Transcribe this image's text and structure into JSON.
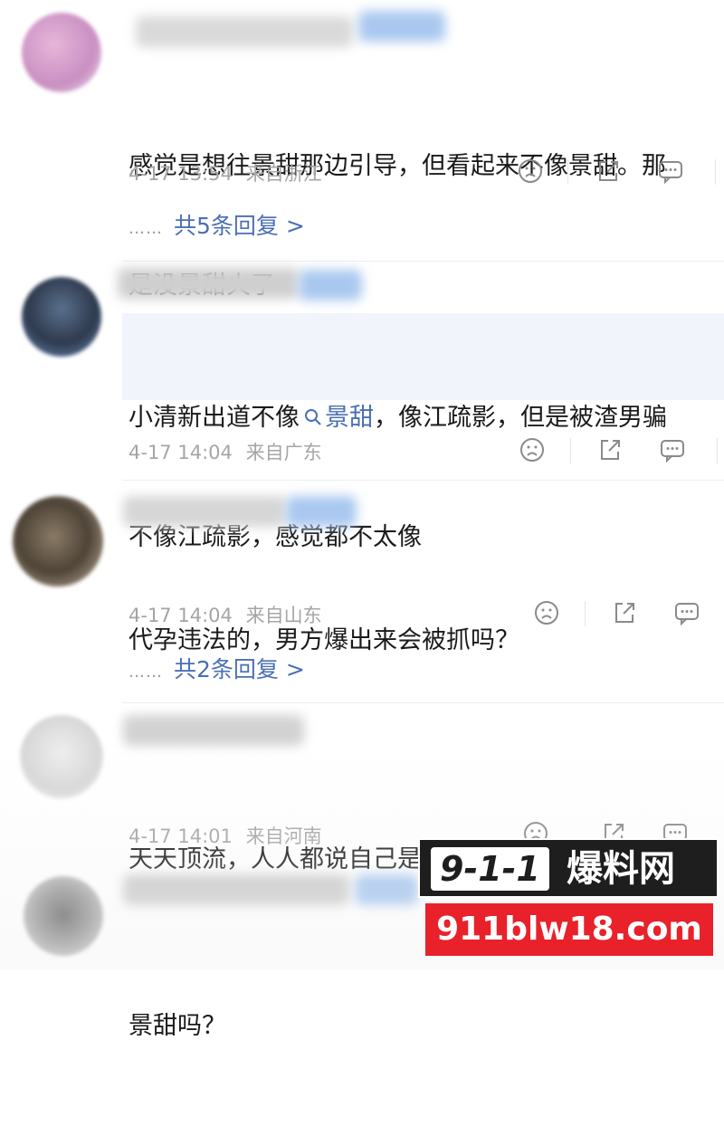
{
  "comments": [
    {
      "text_lines": [
        "感觉是想往景甜那边引导，但看起来不像景甜。那",
        "是没景甜火了"
      ],
      "date": "4-17",
      "time": "13:54",
      "location": "来自浙江",
      "replies_label": "共5条回复 >"
    },
    {
      "text_prefix": "小清新出道不像",
      "search_icon": "search-icon",
      "link_text": "景甜",
      "text_suffix": "，像江疏影，但是被渣男骗",
      "text_line2": "不像江疏影，感觉都不太像",
      "date": "4-17",
      "time": "14:04",
      "location": "来自广东"
    },
    {
      "text_lines": [
        "代孕违法的，男方爆出来会被抓吗？"
      ],
      "date": "4-17",
      "time": "14:04",
      "location": "来自山东",
      "replies_label": "共2条回复 >"
    },
    {
      "text_lines": [
        "天天顶流，人人都说自己是顶流"
      ],
      "date": "4-17",
      "time": "14:01",
      "location": "来自河南"
    },
    {
      "text_lines": [
        "景甜吗？"
      ]
    }
  ],
  "actions": [
    "sad-face-icon",
    "share-icon",
    "comment-icon"
  ],
  "reply_dots": "……",
  "watermark": {
    "brand_num": "9-1-1",
    "brand_cn": "爆料网",
    "url": "911blw18.com"
  },
  "colors": {
    "link": "#4a6fb6",
    "meta": "#a5a5a5",
    "highlight": "#f1f4fb",
    "watermark_red": "#e8212b"
  }
}
